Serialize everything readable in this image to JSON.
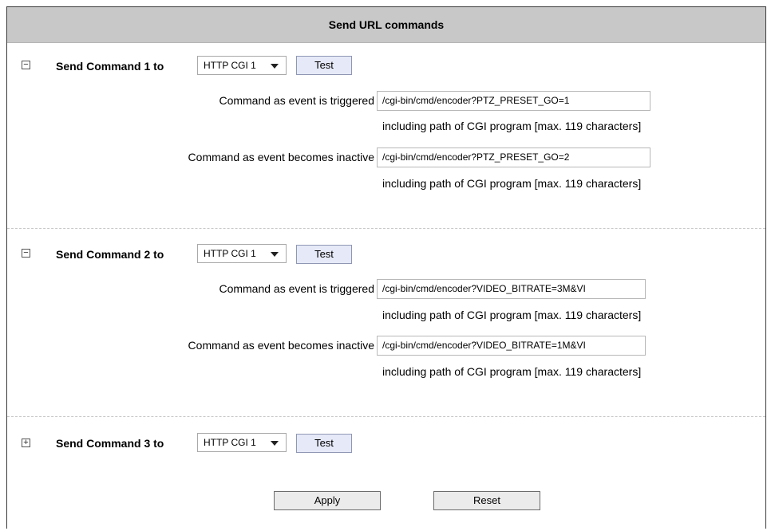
{
  "header": {
    "title": "Send URL commands"
  },
  "commands": [
    {
      "title": "Send Command 1 to",
      "toggle": "−",
      "expanded": true,
      "target": "HTTP CGI 1",
      "test_label": "Test",
      "triggered_label": "Command as event is triggered",
      "triggered_value": "/cgi-bin/cmd/encoder?PTZ_PRESET_GO=1",
      "triggered_hint": "including path of CGI program [max. 119 characters]",
      "inactive_label": "Command as event becomes inactive",
      "inactive_value": "/cgi-bin/cmd/encoder?PTZ_PRESET_GO=2",
      "inactive_hint": "including path of CGI program [max. 119 characters]"
    },
    {
      "title": "Send Command 2 to",
      "toggle": "−",
      "expanded": true,
      "target": "HTTP CGI 1",
      "test_label": "Test",
      "triggered_label": "Command as event is triggered",
      "triggered_value": "/cgi-bin/cmd/encoder?VIDEO_BITRATE=3M&VI",
      "triggered_hint": "including path of CGI program [max. 119 characters]",
      "inactive_label": "Command as event becomes inactive",
      "inactive_value": "/cgi-bin/cmd/encoder?VIDEO_BITRATE=1M&VI",
      "inactive_hint": "including path of CGI program [max. 119 characters]"
    },
    {
      "title": "Send Command 3 to",
      "toggle": "+",
      "expanded": false,
      "target": "HTTP CGI 1",
      "test_label": "Test"
    }
  ],
  "footer": {
    "apply_label": "Apply",
    "reset_label": "Reset"
  }
}
